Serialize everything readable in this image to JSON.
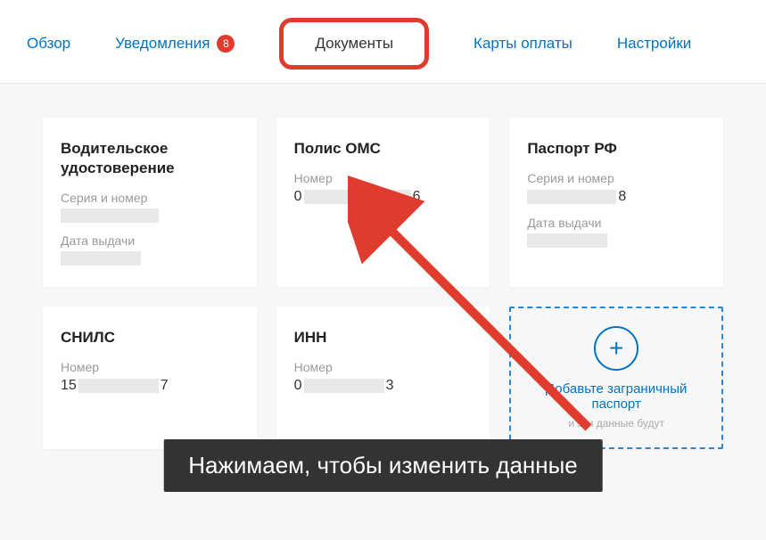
{
  "nav": {
    "overview": "Обзор",
    "notifications": "Уведомления",
    "notifications_badge": "8",
    "documents": "Документы",
    "cards": "Карты оплаты",
    "settings": "Настройки"
  },
  "cards": {
    "driver": {
      "title": "Водительское удостоверение",
      "label_series": "Серия и номер",
      "label_date": "Дата выдачи"
    },
    "oms": {
      "title": "Полис ОМС",
      "label_number": "Номер",
      "value_prefix": "0",
      "value_suffix": "6"
    },
    "passport": {
      "title": "Паспорт РФ",
      "label_series": "Серия и номер",
      "value_suffix": "8",
      "label_date": "Дата выдачи"
    },
    "snils": {
      "title": "СНИЛС",
      "label_number": "Номер",
      "value_prefix": "15",
      "value_suffix": "7"
    },
    "inn": {
      "title": "ИНН",
      "label_number": "Номер",
      "value_prefix": "0",
      "value_suffix": "3"
    },
    "add": {
      "title": "Добавьте заграничный паспорт",
      "subtitle": "и эти данные будут"
    }
  },
  "caption": "Нажимаем, чтобы изменить данные"
}
